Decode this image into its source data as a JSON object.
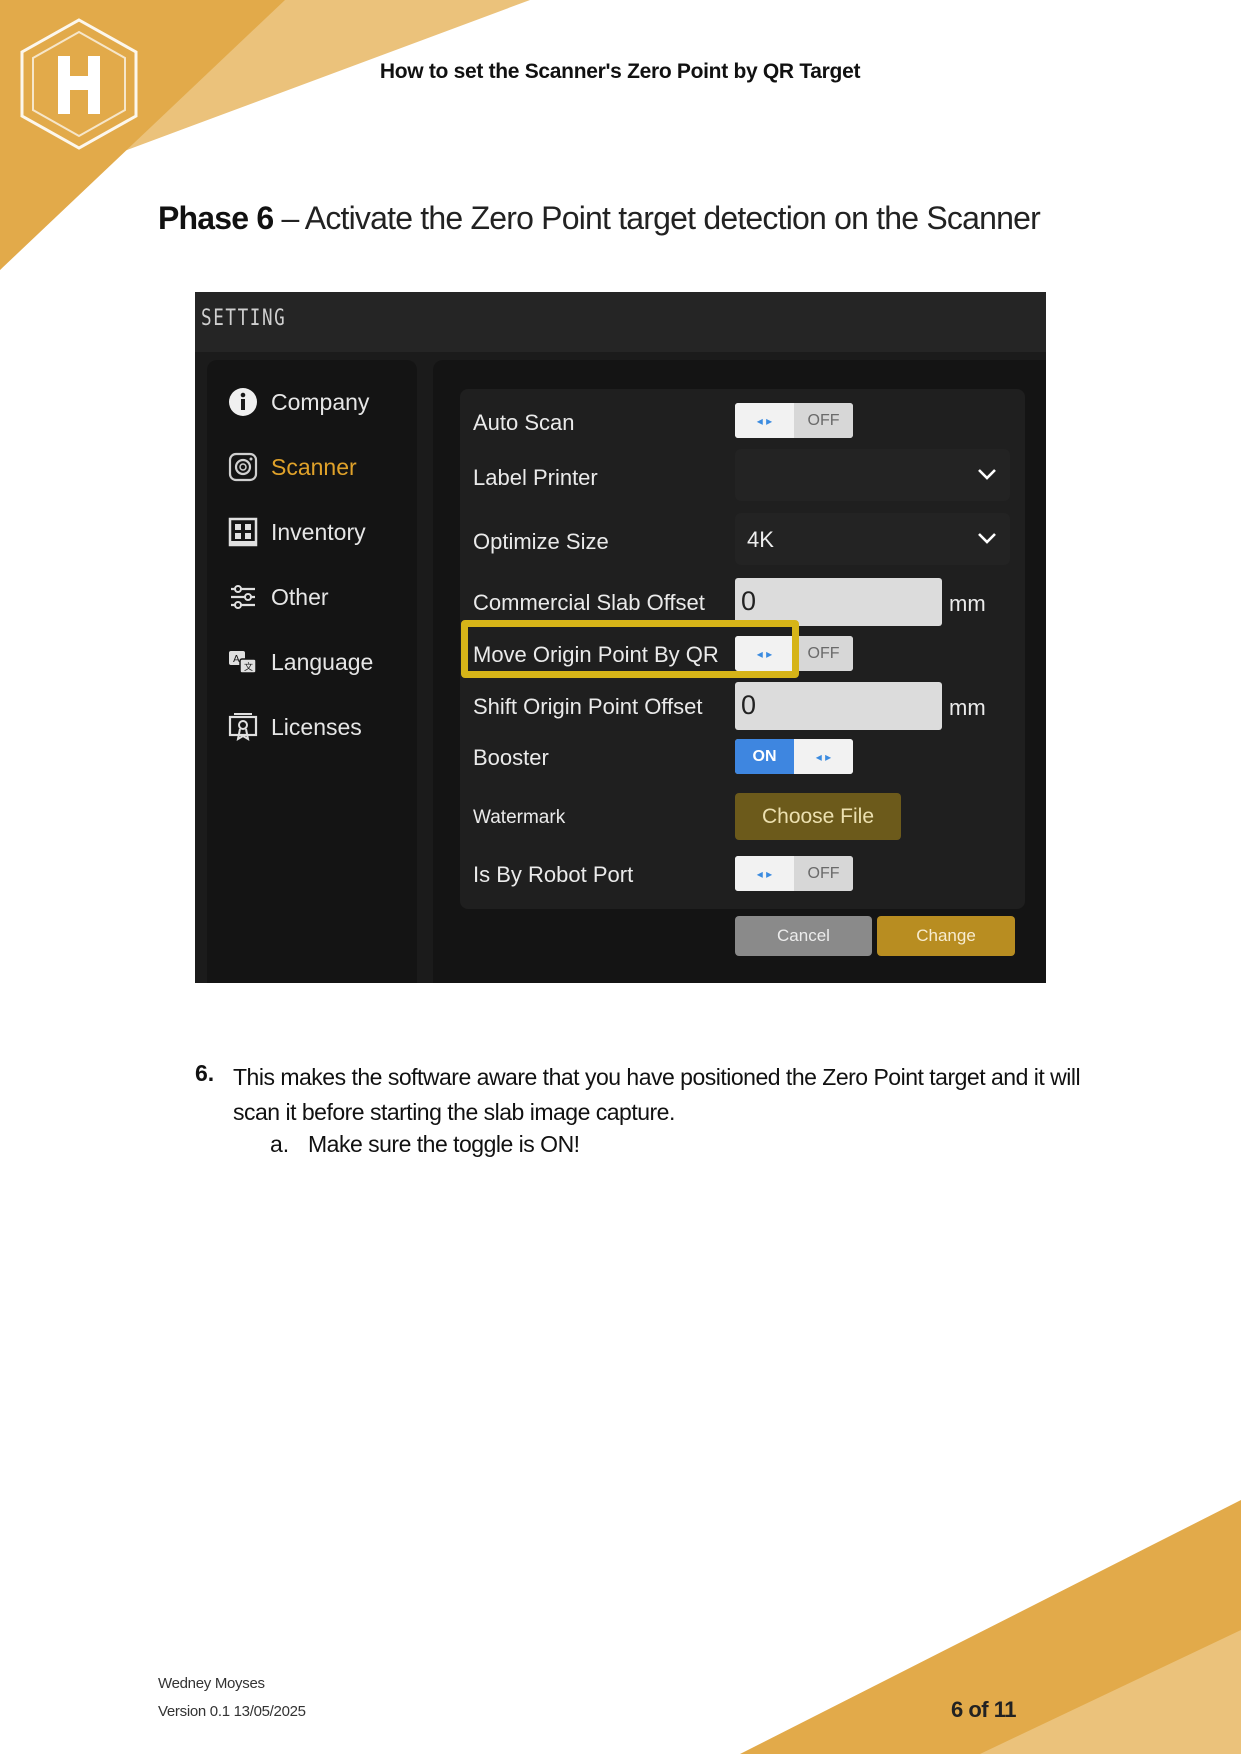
{
  "document": {
    "title": "How to set the Scanner's Zero Point by QR Target",
    "phase_label": "Phase 6",
    "phase_title": "– Activate the Zero Point target detection on the Scanner",
    "step_number": "6.",
    "step_text": "This makes the software aware that you have positioned the Zero Point target and it will scan it before starting the slab image capture.",
    "substep_marker": "a.",
    "substep_text": "Make sure the toggle is ON!",
    "author": "Wedney Moyses",
    "version": "Version 0.1 13/05/2025",
    "page": "6 of 11"
  },
  "colors": {
    "brand_gold": "#e2aa4a",
    "brand_gold_light": "#ebc27b",
    "highlight": "#d6b418",
    "active_nav": "#e0a22a",
    "toggle_on": "#3e86e0"
  },
  "screenshot": {
    "window_title": "SETTING",
    "sidebar": [
      {
        "label": "Company",
        "icon": "info-icon"
      },
      {
        "label": "Scanner",
        "icon": "camera-icon",
        "active": true
      },
      {
        "label": "Inventory",
        "icon": "inventory-icon"
      },
      {
        "label": "Other",
        "icon": "sliders-icon"
      },
      {
        "label": "Language",
        "icon": "language-icon"
      },
      {
        "label": "Licenses",
        "icon": "license-icon"
      }
    ],
    "settings": {
      "auto_scan": {
        "label": "Auto Scan",
        "state": "OFF"
      },
      "label_printer": {
        "label": "Label Printer",
        "value": ""
      },
      "optimize_size": {
        "label": "Optimize Size",
        "value": "4K"
      },
      "commercial_slab_offset": {
        "label": "Commercial Slab Offset",
        "value": "0",
        "unit": "mm"
      },
      "move_origin_point": {
        "label": "Move Origin Point By QR",
        "state": "OFF"
      },
      "shift_origin_point_offset": {
        "label": "Shift Origin Point Offset",
        "value": "0",
        "unit": "mm"
      },
      "booster": {
        "label": "Booster",
        "state": "ON"
      },
      "watermark": {
        "label": "Watermark",
        "button": "Choose File"
      },
      "robot_port": {
        "label": "Is By Robot Port",
        "state": "OFF"
      }
    },
    "actions": {
      "cancel": "Cancel",
      "change": "Change"
    }
  }
}
